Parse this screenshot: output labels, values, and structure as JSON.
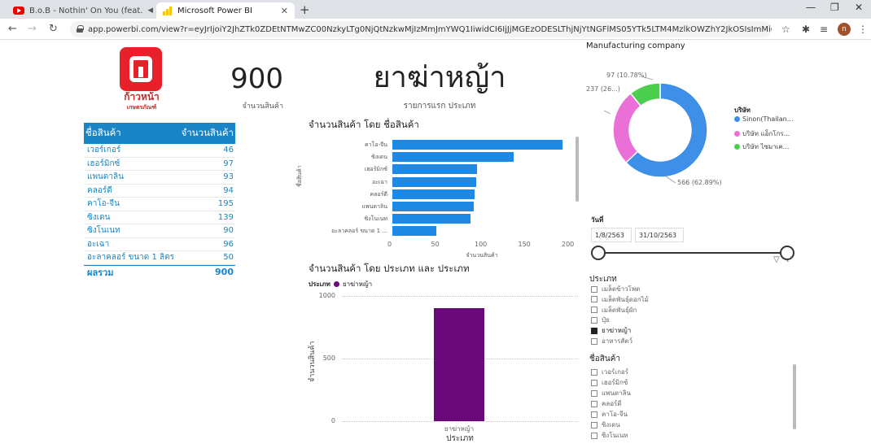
{
  "browser": {
    "tabs": [
      {
        "title": "B.o.B - Nothin' On You (feat.",
        "active": false
      },
      {
        "title": "Microsoft Power BI",
        "active": true
      }
    ],
    "url": "app.powerbi.com/view?r=eyJrIjoiY2JhZTk0ZDEtNTMwZC00NzkyLTg0NjQtNzkwMjIzMmJmYWQ1IiwidCI6IjJjMGEzODESLThjNjYtNGFlMS05YTk5LTM4MzlkOWZhY2JkOSIsImMiOjEwfQ%3D%3D",
    "avatar_initial": "n"
  },
  "logo": {
    "text": "ก้าวหน้า",
    "sub": "เกษตรภัณฑ์"
  },
  "kpi_total": {
    "value": "900",
    "label": "จำนวนสินค้า"
  },
  "kpi_type": {
    "value": "ยาฆ่าหญ้า",
    "label": "รายการแรก ประเภท"
  },
  "product_table": {
    "headers": [
      "ชื่อสินค้า",
      "จำนวนสินค้า"
    ],
    "rows": [
      {
        "name": "เวอร์เกอร์",
        "qty": "46"
      },
      {
        "name": "เฮอร์มิกซ์",
        "qty": "97"
      },
      {
        "name": "แพนดาลิน",
        "qty": "93"
      },
      {
        "name": "คลอร์ดี",
        "qty": "94"
      },
      {
        "name": "คาโอ-จีน",
        "qty": "195"
      },
      {
        "name": "ซิงเดน",
        "qty": "139"
      },
      {
        "name": "ซิงโนเนท",
        "qty": "90"
      },
      {
        "name": "อะเฉา",
        "qty": "96"
      },
      {
        "name": "อะลาคลอร์ ขนาด 1 ลิตร",
        "qty": "50"
      }
    ],
    "total_label": "ผลรวม",
    "total_value": "900"
  },
  "chart_data": [
    {
      "type": "bar",
      "title": "จำนวนสินค้า โดย ชื่อสินค้า",
      "ylabel": "ชื่อสินค้า",
      "xlabel": "จำนวนสินค้า",
      "categories": [
        "คาโอ-จีน",
        "ซิงเดน",
        "เฮอร์มิกซ์",
        "อะเฉา",
        "คลอร์ดี",
        "แพนดาลิน",
        "ซิงโนเนท",
        "อะลาคลอร์ ขนาด 1 ..."
      ],
      "values": [
        195,
        139,
        97,
        96,
        94,
        93,
        90,
        50
      ],
      "xticks": [
        "0",
        "50",
        "100",
        "150",
        "200"
      ],
      "xlim": [
        0,
        200
      ]
    },
    {
      "type": "bar",
      "title": "จำนวนสินค้า โดย ประเภท และ ประเภท",
      "legend_title": "ประเภท",
      "legend": [
        "ยาฆ่าหญ้า"
      ],
      "categories": [
        "ยาฆ่าหญ้า"
      ],
      "values": [
        900
      ],
      "ylabel": "จำนวนสินค้า",
      "xlabel": "ประเภท",
      "yticks": [
        "1000",
        "500",
        "0"
      ],
      "ylim": [
        0,
        1000
      ],
      "color": "#6a0a7a"
    },
    {
      "type": "pie",
      "title": "Manufacturing company",
      "legend_title": "บริษัท",
      "slices": [
        {
          "name": "Sinon(Thailan...",
          "value": 566,
          "label": "566 (62.89%)",
          "color": "#3d8fe8"
        },
        {
          "name": "บริษัท แอ็กโกร...",
          "value": 237,
          "label": "237 (26...)",
          "color": "#ea6fd6"
        },
        {
          "name": "บริษัท ไซมาเค...",
          "value": 97,
          "label": "97 (10.78%)",
          "color": "#4ccf4f"
        }
      ]
    }
  ],
  "date_slicer": {
    "title": "วันที่",
    "start": "1/8/2563",
    "end": "31/10/2563"
  },
  "type_slicer": {
    "title": "ประเภท",
    "items": [
      {
        "label": "เมล็ดข้าวโพด",
        "checked": false
      },
      {
        "label": "เมล็ดพันธุ์ดอกไม้",
        "checked": false
      },
      {
        "label": "เมล็ดพันธุ์ผัก",
        "checked": false
      },
      {
        "label": "ปุ๋ย",
        "checked": false
      },
      {
        "label": "ยาฆ่าหญ้า",
        "checked": true
      },
      {
        "label": "อาหารสัตว์",
        "checked": false
      }
    ]
  },
  "product_slicer": {
    "title": "ชื่อสินค้า",
    "items": [
      "เวอร์เกอร์",
      "เฮอร์มิกซ์",
      "แพนดาลิน",
      "คลอร์ดี",
      "คาโอ-จีน",
      "ซิงเดน",
      "ซิงโนเนท"
    ]
  }
}
